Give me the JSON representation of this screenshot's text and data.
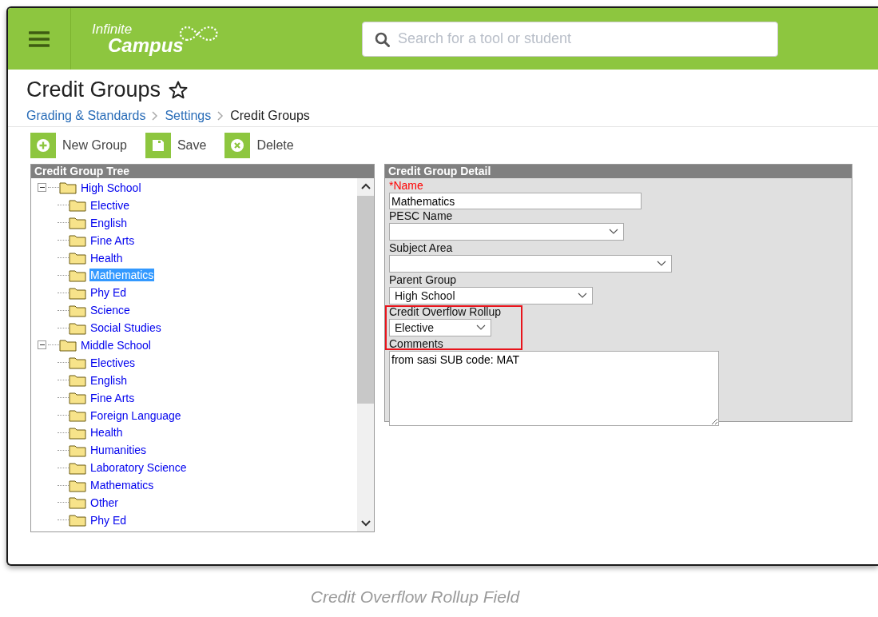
{
  "header": {
    "logo": [
      "Infinite",
      "Campus"
    ],
    "search": {
      "placeholder": "Search for a tool or student"
    }
  },
  "page": {
    "title": "Credit Groups",
    "favorite": false,
    "breadcrumb": [
      {
        "label": "Grading & Standards",
        "link": true
      },
      {
        "label": "Settings",
        "link": true
      },
      {
        "label": "Credit Groups",
        "link": false
      }
    ]
  },
  "toolbar": [
    {
      "kind": "add",
      "label": "New Group"
    },
    {
      "kind": "save",
      "label": "Save"
    },
    {
      "kind": "delete",
      "label": "Delete"
    }
  ],
  "tree": {
    "title": "Credit Group Tree",
    "items": [
      {
        "label": "High School",
        "expanded": true,
        "selected": false,
        "children": [
          {
            "label": "Elective",
            "selected": false
          },
          {
            "label": "English",
            "selected": false
          },
          {
            "label": "Fine Arts",
            "selected": false
          },
          {
            "label": "Health",
            "selected": false
          },
          {
            "label": "Mathematics",
            "selected": true
          },
          {
            "label": "Phy Ed",
            "selected": false
          },
          {
            "label": "Science",
            "selected": false
          },
          {
            "label": "Social Studies",
            "selected": false
          }
        ]
      },
      {
        "label": "Middle School",
        "expanded": true,
        "selected": false,
        "children": [
          {
            "label": "Electives",
            "selected": false
          },
          {
            "label": "English",
            "selected": false
          },
          {
            "label": "Fine Arts",
            "selected": false
          },
          {
            "label": "Foreign Language",
            "selected": false
          },
          {
            "label": "Health",
            "selected": false
          },
          {
            "label": "Humanities",
            "selected": false
          },
          {
            "label": "Laboratory Science",
            "selected": false
          },
          {
            "label": "Mathematics",
            "selected": false
          },
          {
            "label": "Other",
            "selected": false
          },
          {
            "label": "Phy Ed",
            "selected": false
          }
        ]
      }
    ]
  },
  "detail": {
    "title": "Credit Group Detail",
    "fields": [
      {
        "kind": "text",
        "label": "*Name",
        "required": true,
        "value": "Mathematics",
        "highlighted": false
      },
      {
        "kind": "select",
        "label": "PESC Name",
        "required": false,
        "highlighted": false
      },
      {
        "kind": "select",
        "label": "Subject Area",
        "required": false,
        "highlighted": false
      },
      {
        "kind": "select",
        "label": "Parent Group",
        "required": false,
        "value": "High School",
        "highlighted": false
      },
      {
        "kind": "select",
        "label": "Credit Overflow Rollup",
        "required": false,
        "value": "Elective",
        "highlighted": true
      },
      {
        "kind": "textarea",
        "label": "Comments",
        "required": false,
        "value": "from sasi SUB code: MAT",
        "highlighted": false
      }
    ]
  },
  "caption": "Credit Overflow Rollup Field"
}
